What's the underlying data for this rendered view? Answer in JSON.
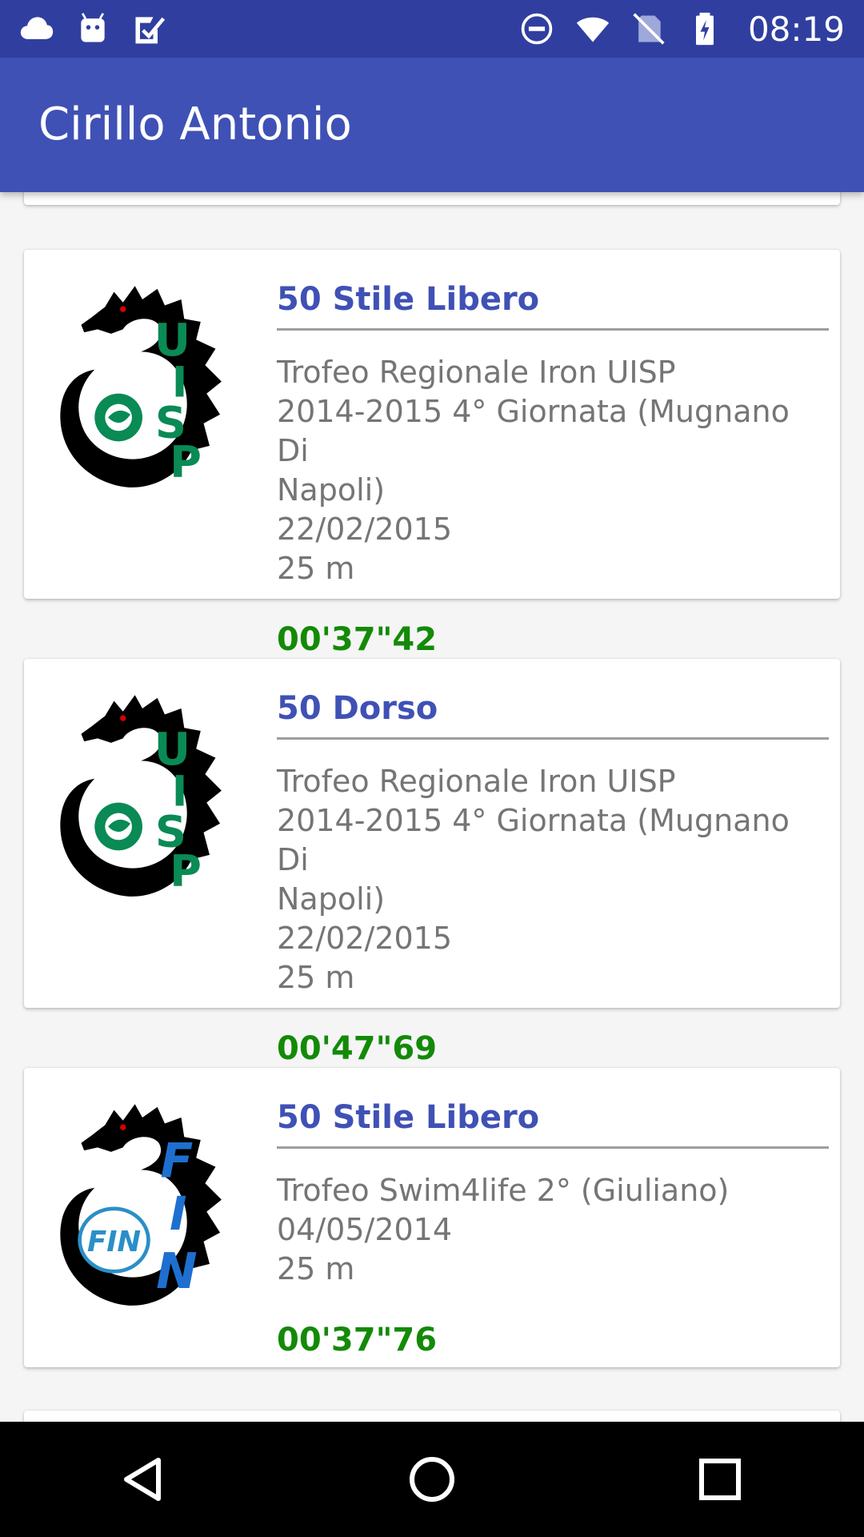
{
  "status_bar": {
    "time": "08:19",
    "left_icons": [
      "cloud-icon",
      "android-icon",
      "task-check-icon"
    ],
    "right_icons": [
      "do-not-disturb-icon",
      "wifi-icon",
      "no-sim-icon",
      "battery-charging-icon"
    ]
  },
  "app_bar": {
    "title": "Cirillo Antonio"
  },
  "colors": {
    "status_bar": "#303f9f",
    "app_bar": "#3f51b5",
    "title_blue": "#3f51b5",
    "time_green": "#138a07",
    "info_gray": "#757575"
  },
  "results": [
    {
      "logo": "uisp-logo",
      "event": "50 Stile Libero",
      "meet_line1": "Trofeo Regionale Iron UISP",
      "meet_line2": "2014-2015 4° Giornata (Mugnano Di",
      "meet_line3": "Napoli)",
      "date": "22/02/2015",
      "pool": "25 m",
      "time": "00'37\"42"
    },
    {
      "logo": "uisp-logo",
      "event": "50 Dorso",
      "meet_line1": "Trofeo Regionale Iron UISP",
      "meet_line2": "2014-2015 4° Giornata (Mugnano Di",
      "meet_line3": "Napoli)",
      "date": "22/02/2015",
      "pool": "25 m",
      "time": "00'47\"69"
    },
    {
      "logo": "fin-logo",
      "event": "50 Stile Libero",
      "meet_line1": "Trofeo Swim4life 2° (Giuliano)",
      "date": "04/05/2014",
      "pool": "25 m",
      "time": "00'37\"76"
    }
  ],
  "nav_bar": {
    "buttons": [
      "back-icon",
      "home-icon",
      "recents-icon"
    ]
  }
}
